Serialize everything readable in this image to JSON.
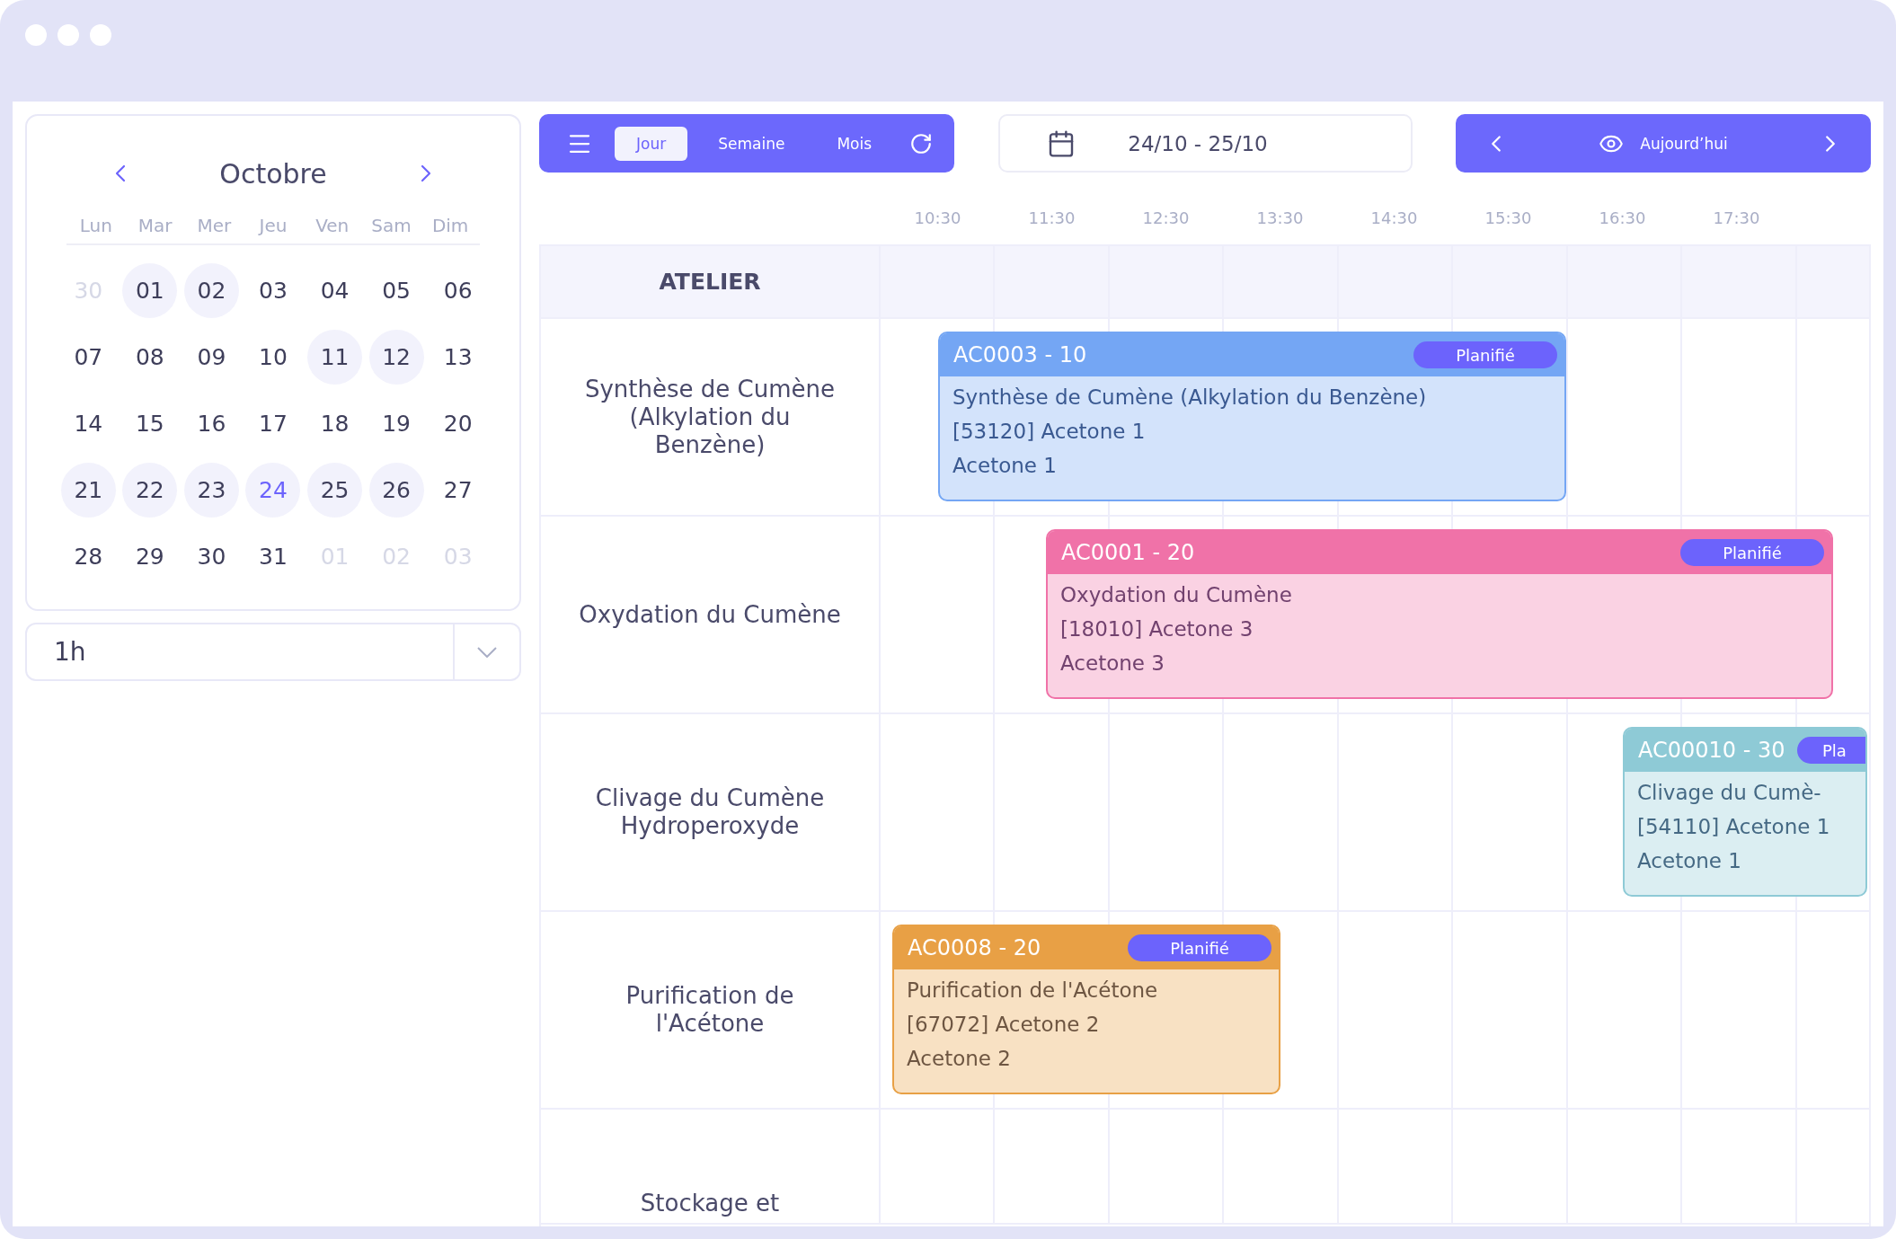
{
  "calendar": {
    "month": "Octobre",
    "weekdays": [
      "Lun",
      "Mar",
      "Mer",
      "Jeu",
      "Ven",
      "Sam",
      "Dim"
    ],
    "days": [
      {
        "label": "30",
        "muted": true,
        "highlighted": false,
        "selected": false
      },
      {
        "label": "01",
        "muted": false,
        "highlighted": true,
        "selected": false
      },
      {
        "label": "02",
        "muted": false,
        "highlighted": true,
        "selected": false
      },
      {
        "label": "03",
        "muted": false,
        "highlighted": false,
        "selected": false
      },
      {
        "label": "04",
        "muted": false,
        "highlighted": false,
        "selected": false
      },
      {
        "label": "05",
        "muted": false,
        "highlighted": false,
        "selected": false
      },
      {
        "label": "06",
        "muted": false,
        "highlighted": false,
        "selected": false
      },
      {
        "label": "07",
        "muted": false,
        "highlighted": false,
        "selected": false
      },
      {
        "label": "08",
        "muted": false,
        "highlighted": false,
        "selected": false
      },
      {
        "label": "09",
        "muted": false,
        "highlighted": false,
        "selected": false
      },
      {
        "label": "10",
        "muted": false,
        "highlighted": false,
        "selected": false
      },
      {
        "label": "11",
        "muted": false,
        "highlighted": true,
        "selected": false
      },
      {
        "label": "12",
        "muted": false,
        "highlighted": true,
        "selected": false
      },
      {
        "label": "13",
        "muted": false,
        "highlighted": false,
        "selected": false
      },
      {
        "label": "14",
        "muted": false,
        "highlighted": false,
        "selected": false
      },
      {
        "label": "15",
        "muted": false,
        "highlighted": false,
        "selected": false
      },
      {
        "label": "16",
        "muted": false,
        "highlighted": false,
        "selected": false
      },
      {
        "label": "17",
        "muted": false,
        "highlighted": false,
        "selected": false
      },
      {
        "label": "18",
        "muted": false,
        "highlighted": false,
        "selected": false
      },
      {
        "label": "19",
        "muted": false,
        "highlighted": false,
        "selected": false
      },
      {
        "label": "20",
        "muted": false,
        "highlighted": false,
        "selected": false
      },
      {
        "label": "21",
        "muted": false,
        "highlighted": true,
        "selected": false
      },
      {
        "label": "22",
        "muted": false,
        "highlighted": true,
        "selected": false
      },
      {
        "label": "23",
        "muted": false,
        "highlighted": true,
        "selected": false
      },
      {
        "label": "24",
        "muted": false,
        "highlighted": true,
        "selected": true
      },
      {
        "label": "25",
        "muted": false,
        "highlighted": true,
        "selected": false
      },
      {
        "label": "26",
        "muted": false,
        "highlighted": true,
        "selected": false
      },
      {
        "label": "27",
        "muted": false,
        "highlighted": false,
        "selected": false
      },
      {
        "label": "28",
        "muted": false,
        "highlighted": false,
        "selected": false
      },
      {
        "label": "29",
        "muted": false,
        "highlighted": false,
        "selected": false
      },
      {
        "label": "30",
        "muted": false,
        "highlighted": false,
        "selected": false
      },
      {
        "label": "31",
        "muted": false,
        "highlighted": false,
        "selected": false
      },
      {
        "label": "01",
        "muted": true,
        "highlighted": false,
        "selected": false
      },
      {
        "label": "02",
        "muted": true,
        "highlighted": false,
        "selected": false
      },
      {
        "label": "03",
        "muted": true,
        "highlighted": false,
        "selected": false
      }
    ]
  },
  "interval": {
    "value": "1h"
  },
  "toolbar": {
    "views": [
      {
        "label": "Jour",
        "selected": true
      },
      {
        "label": "Semaine",
        "selected": false
      },
      {
        "label": "Mois",
        "selected": false
      }
    ],
    "date_range": "24/10 - 25/10",
    "today": "Aujourd’hui"
  },
  "schedule": {
    "header": "ATELIER",
    "times": [
      "10:30",
      "11:30",
      "12:30",
      "13:30",
      "14:30",
      "15:30",
      "16:30",
      "17:30"
    ],
    "rows": [
      {
        "label": "Synthèse de Cumène (Alkylation du Benzène)",
        "events": [
          {
            "code": "AC0003 - 10",
            "status": "Planifié",
            "color": "#74a6f4",
            "lines": [
              "Synthèse de Cumène (Alkylation du Benzène)",
              "[53120] Acetone 1",
              "Acetone 1"
            ]
          }
        ]
      },
      {
        "label": "Oxydation du Cumène",
        "events": [
          {
            "code": "AC0001 - 20",
            "status": "Planifié",
            "color": "#f072a8",
            "lines": [
              "Oxydation du Cumène",
              "[18010] Acetone 3",
              "Acetone 3"
            ]
          }
        ]
      },
      {
        "label": "Clivage du Cumène Hydroperoxyde",
        "events": [
          {
            "code": "AC00010 - 30",
            "status": "Pla",
            "color": "#8ecad6",
            "lines": [
              "Clivage du Cumè-",
              "[54110] Acetone 1",
              "Acetone 1"
            ]
          }
        ]
      },
      {
        "label": "Purification de l'Acétone",
        "events": [
          {
            "code": "AC0008 - 20",
            "status": "Planifié",
            "color": "#e8a045",
            "lines": [
              "Purification de l'Acétone",
              "[67072] Acetone 2",
              "Acetone 2"
            ]
          }
        ]
      },
      {
        "label": "Stockage et",
        "events": []
      }
    ]
  }
}
